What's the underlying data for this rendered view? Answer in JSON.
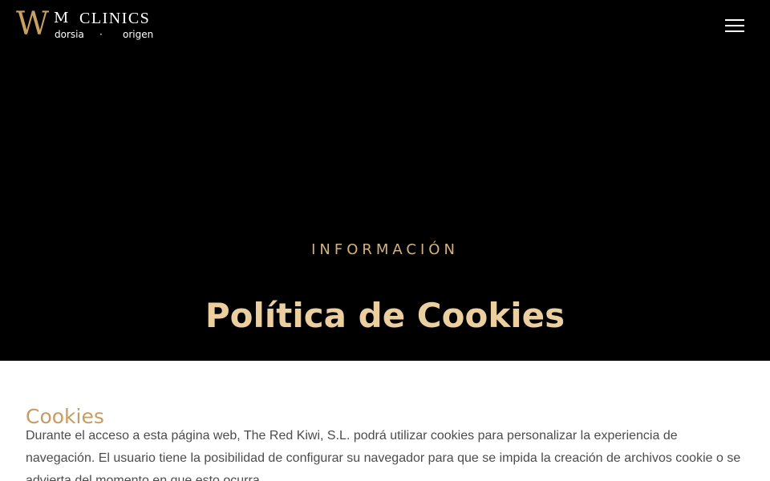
{
  "header": {
    "logo": {
      "w": "W",
      "m": "M",
      "clinics": "CLINICS",
      "dorsia": "dorsia",
      "separator": "·",
      "origen": "origen"
    },
    "menu_icon": "hamburger-menu-icon"
  },
  "hero": {
    "eyebrow": "INFORMACIÓN",
    "title": "Política de Cookies"
  },
  "content": {
    "heading": "Cookies",
    "paragraph": "Durante el acceso a esta página web, The Red Kiwi, S.L. podrá utilizar cookies para personalizar la experiencia de navegación. El usuario tiene la posibilidad de configurar su navegador para que se impida la creación de archivos cookie o se advierta del momento en que esto ocurra."
  },
  "colors": {
    "hero_background": "#000000",
    "gold": "#c9a062",
    "title_gold": "#ebcf9e",
    "text": "#4c4c4c"
  }
}
